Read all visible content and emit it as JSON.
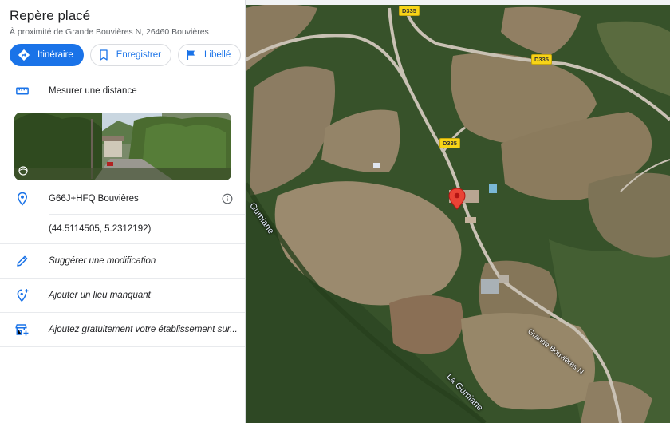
{
  "place": {
    "title": "Repère placé",
    "address": "À proximité de Grande Bouvières N, 26460 Bouvières"
  },
  "actions": [
    {
      "label": "Itinéraire",
      "icon": "directions-icon"
    },
    {
      "label": "Enregistrer",
      "icon": "bookmark-icon"
    },
    {
      "label": "Libellé",
      "icon": "flag-icon"
    }
  ],
  "measure": {
    "label": "Mesurer une distance",
    "icon": "ruler-icon"
  },
  "plus_code": {
    "label": "G66J+HFQ Bouvières",
    "icon": "location-pin-icon"
  },
  "coordinates": {
    "label": "(44.5114505, 5.2312192)"
  },
  "suggest": {
    "label": "Suggérer une modification",
    "icon": "pencil-icon"
  },
  "add_place": {
    "label": "Ajouter un lieu manquant",
    "icon": "add-location-icon"
  },
  "add_business": {
    "label": "Ajoutez gratuitement votre établissement sur...",
    "icon": "add-business-icon"
  },
  "map": {
    "road_shields": [
      "D335",
      "D335",
      "D335"
    ],
    "road_label": "Grande Bouvières N",
    "river_labels": [
      "Gumiane",
      "La Gumiane"
    ]
  },
  "colors": {
    "accent": "#1a73e8",
    "marker": "#ea4335",
    "shield": "#f7d417"
  }
}
